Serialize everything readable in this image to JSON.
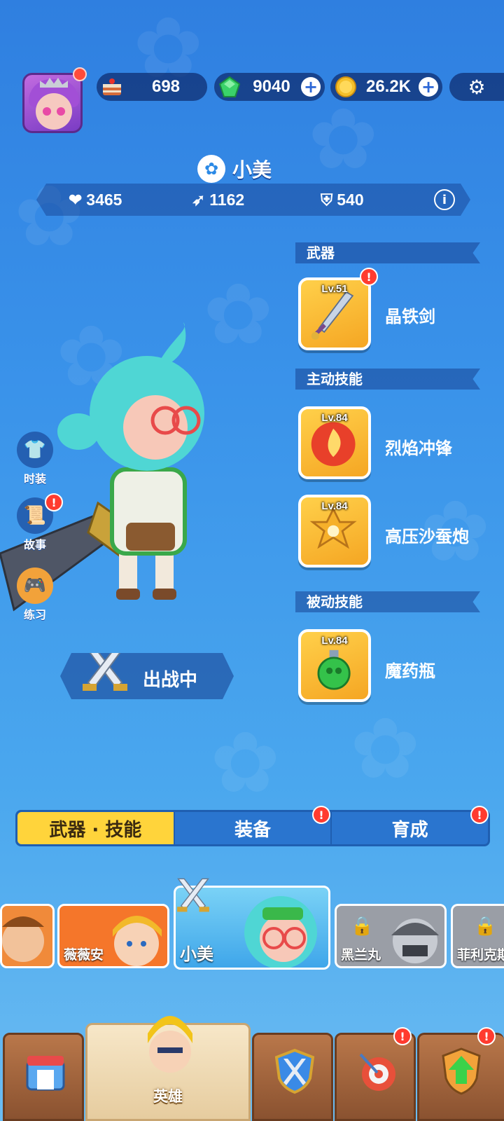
{
  "resources": {
    "cake": {
      "value": "698",
      "icon": "cake-icon"
    },
    "gems": {
      "value": "9040",
      "icon": "green-gem-icon"
    },
    "coins": {
      "value": "26.2K",
      "icon": "gold-coin-icon"
    }
  },
  "hero": {
    "name": "小美",
    "hp": "3465",
    "attack": "1162",
    "defense": "540"
  },
  "sections": {
    "weapon": "武器",
    "active_skill": "主动技能",
    "passive_skill": "被动技能"
  },
  "items": {
    "weapon": {
      "level": "Lv.51",
      "name": "晶铁剑"
    },
    "active1": {
      "level": "Lv.84",
      "name": "烈焰冲锋"
    },
    "active2": {
      "level": "Lv.84",
      "name": "高压沙蚕炮"
    },
    "passive1": {
      "level": "Lv.84",
      "name": "魔药瓶"
    }
  },
  "side_buttons": {
    "outfit": "时装",
    "story": "故事",
    "practice": "练习"
  },
  "battle_status": "出战中",
  "tabs": [
    "武器 · 技能",
    "装备",
    "育成"
  ],
  "roster": [
    {
      "name": "",
      "locked": false
    },
    {
      "name": "薇薇安",
      "locked": false
    },
    {
      "name": "小美",
      "locked": false
    },
    {
      "name": "黑兰丸",
      "locked": true
    },
    {
      "name": "菲利克斯",
      "locked": true
    }
  ],
  "bottom_nav": {
    "hero_label": "英雄"
  },
  "colors": {
    "active_tab": "#ffd43b",
    "alert_red": "#ff3b2f",
    "bg_top": "#2f7fe0"
  }
}
